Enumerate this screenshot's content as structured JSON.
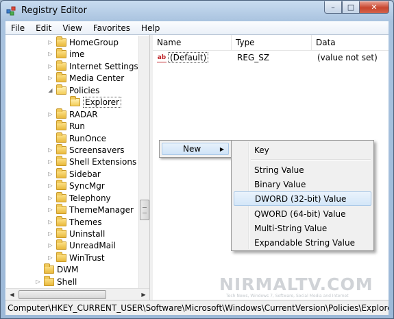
{
  "window": {
    "title": "Registry Editor",
    "minimize": "–",
    "maximize": "□",
    "close": "✕"
  },
  "menubar": [
    "File",
    "Edit",
    "View",
    "Favorites",
    "Help"
  ],
  "tree": {
    "items": [
      {
        "label": "HomeGroup",
        "expander": "▷"
      },
      {
        "label": "ime",
        "expander": "▷"
      },
      {
        "label": "Internet Settings",
        "expander": "▷"
      },
      {
        "label": "Media Center",
        "expander": "▷"
      },
      {
        "label": "Policies",
        "expander": "◢"
      },
      {
        "label": "Explorer",
        "expander": "",
        "selected": true
      },
      {
        "label": "RADAR",
        "expander": "▷"
      },
      {
        "label": "Run",
        "expander": ""
      },
      {
        "label": "RunOnce",
        "expander": ""
      },
      {
        "label": "Screensavers",
        "expander": "▷"
      },
      {
        "label": "Shell Extensions",
        "expander": "▷"
      },
      {
        "label": "Sidebar",
        "expander": "▷"
      },
      {
        "label": "SyncMgr",
        "expander": "▷"
      },
      {
        "label": "Telephony",
        "expander": "▷"
      },
      {
        "label": "ThemeManager",
        "expander": "▷"
      },
      {
        "label": "Themes",
        "expander": "▷"
      },
      {
        "label": "Uninstall",
        "expander": "▷"
      },
      {
        "label": "UnreadMail",
        "expander": "▷"
      },
      {
        "label": "WinTrust",
        "expander": "▷"
      },
      {
        "label": "DWM",
        "expander": ""
      },
      {
        "label": "Shell",
        "expander": "▷"
      }
    ]
  },
  "list": {
    "columns": [
      "Name",
      "Type",
      "Data"
    ],
    "rows": [
      {
        "name": "(Default)",
        "type": "REG_SZ",
        "data": "(value not set)",
        "icon": "ab"
      }
    ]
  },
  "context_menu": {
    "new_label": "New",
    "arrow": "▶",
    "submenu": [
      "Key",
      "String Value",
      "Binary Value",
      "DWORD (32-bit) Value",
      "QWORD (64-bit) Value",
      "Multi-String Value",
      "Expandable String Value"
    ],
    "highlighted": "DWORD (32-bit) Value"
  },
  "statusbar": {
    "path": "Computer\\HKEY_CURRENT_USER\\Software\\Microsoft\\Windows\\CurrentVersion\\Policies\\Explorer"
  },
  "watermark": {
    "text": "NIRMALTV.COM",
    "sub": "Tech News, Windows 7, Software, Social Media and Internet"
  }
}
